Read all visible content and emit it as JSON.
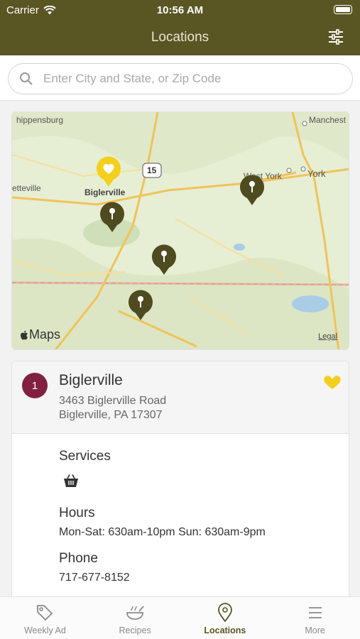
{
  "status_bar": {
    "carrier": "Carrier",
    "time": "10:56 AM"
  },
  "nav": {
    "title": "Locations"
  },
  "search": {
    "placeholder": "Enter City and State, or Zip Code"
  },
  "map": {
    "labels": [
      "hippensburg",
      "Manchest",
      "etteville",
      "Biglerville",
      "West York",
      "York",
      "15"
    ],
    "brand": "Maps",
    "legal": "Legal"
  },
  "location": {
    "number": "1",
    "name": "Biglerville",
    "address_line1": "3463 Biglerville Road",
    "address_line2": "Biglerville, PA 17307",
    "favorite": true,
    "services_label": "Services",
    "services_icons": [
      "shopping-basket-icon"
    ],
    "hours_label": "Hours",
    "hours": "Mon-Sat: 630am-10pm Sun: 630am-9pm",
    "phone_label": "Phone",
    "phone": "717-677-8152"
  },
  "tabs": [
    {
      "label": "Weekly Ad",
      "icon": "tag-icon",
      "active": false
    },
    {
      "label": "Recipes",
      "icon": "bowl-icon",
      "active": false
    },
    {
      "label": "Locations",
      "icon": "map-pin-icon",
      "active": true
    },
    {
      "label": "More",
      "icon": "menu-icon",
      "active": false
    }
  ],
  "colors": {
    "nav_bg": "#5a5623",
    "pin": "#4f4b20",
    "favorite": "#f4cf1c",
    "badge": "#822042"
  }
}
